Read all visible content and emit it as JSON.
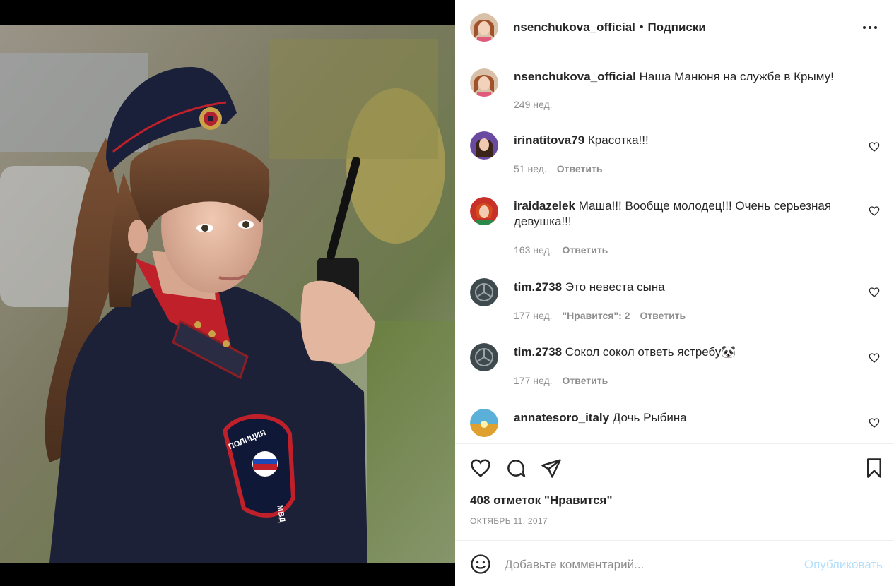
{
  "post": {
    "author": "nsenchukova_official",
    "separator": "•",
    "follow_status": "Подписки",
    "more_icon": "more-horizontal-icon",
    "caption": {
      "user": "nsenchukova_official",
      "text": "Наша Манюня на службе в Крыму!",
      "age": "249 нед."
    },
    "photo_patch_text": "ПОЛИЦИЯ",
    "photo_patch_text2": "МВД"
  },
  "comments": [
    {
      "user": "irinatitova79",
      "text": "Красотка!!!",
      "age": "51 нед.",
      "likes": "",
      "reply": "Ответить"
    },
    {
      "user": "iraidazelek",
      "text": "Маша!!! Вообще молодец!!! Очень серьезная девушка!!!",
      "age": "163 нед.",
      "likes": "",
      "reply": "Ответить"
    },
    {
      "user": "tim.2738",
      "text": "Это невеста сына",
      "age": "177 нед.",
      "likes": "\"Нравится\": 2",
      "reply": "Ответить"
    },
    {
      "user": "tim.2738",
      "text": "Сокол сокол ответь ястребу🐼",
      "age": "177 нед.",
      "likes": "",
      "reply": "Ответить"
    },
    {
      "user": "annatesoro_italy",
      "text": "Дочь Рыбина",
      "age": "",
      "likes": "",
      "reply": ""
    }
  ],
  "actions": {
    "like_icon": "heart-icon",
    "comment_icon": "comment-icon",
    "share_icon": "send-icon",
    "save_icon": "bookmark-icon",
    "likes_text": "408 отметок \"Нравится\"",
    "date": "ОКТЯБРЬ 11, 2017"
  },
  "add_comment": {
    "emoji_icon": "emoji-icon",
    "placeholder": "Добавьте комментарий...",
    "publish": "Опубликовать"
  },
  "colors": {
    "text": "#262626",
    "muted": "#8e8e8e",
    "publish_disabled": "#b2dffc",
    "border": "#efefef"
  }
}
